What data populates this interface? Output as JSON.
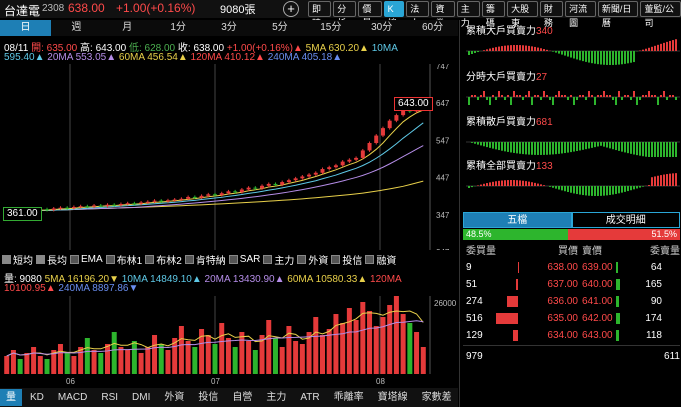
{
  "header": {
    "name": "台達電",
    "code": "2308",
    "price": "638.00",
    "change": "+1.00(+0.16%)",
    "volume": "9080張",
    "plus": "+"
  },
  "right_tabs": [
    "即時",
    "分析",
    "價量",
    "K線",
    "法人",
    "資券",
    "主力",
    "籌碼",
    "大股東",
    "財務",
    "河流圖",
    "新聞/日曆",
    "董監/公司"
  ],
  "active_right_tab": "K線",
  "period_tabs": [
    "日",
    "週",
    "月",
    "1分",
    "3分",
    "5分",
    "15分",
    "30分",
    "60分"
  ],
  "active_period": "日",
  "ohlc": {
    "date": "08/11",
    "open": "開: 635.00",
    "high": "高: 643.00",
    "low": "低: 628.00",
    "close": "收: 638.00",
    "chg": "+1.00(+0.16%)▲"
  },
  "ma": {
    "ma5": "5MA 630.20▲",
    "ma10": "10MA",
    "ma10v": "595.40▲",
    "ma20": "20MA 553.05▲",
    "ma60": "60MA 456.54▲",
    "ma120": "120MA 410.12▲",
    "ma240": "240MA 405.18▲"
  },
  "price_axis": [
    "747",
    "647",
    "547",
    "447",
    "347",
    "247"
  ],
  "high_tag": "643.00",
  "low_tag": "361.00",
  "indicators": [
    {
      "label": "短均",
      "on": true
    },
    {
      "label": "長均",
      "on": true
    },
    {
      "label": "EMA",
      "on": false
    },
    {
      "label": "布林1",
      "on": false
    },
    {
      "label": "布林2",
      "on": false
    },
    {
      "label": "肯特納",
      "on": false
    },
    {
      "label": "SAR",
      "on": false
    },
    {
      "label": "主力",
      "on": false
    },
    {
      "label": "外資",
      "on": false
    },
    {
      "label": "投信",
      "on": false
    },
    {
      "label": "融資",
      "on": false
    }
  ],
  "vol_line1": {
    "a": "量: 9080",
    "b": "5MA 16196.20▼",
    "c": "10MA 14849.10▲",
    "d": "20MA 13430.90▲",
    "e": "60MA 10580.33▲",
    "f": "120MA"
  },
  "vol_line2": {
    "a": "10100.95▲",
    "b": "240MA 8897.86▼"
  },
  "vol_axis": "26000",
  "months": [
    "06",
    "07",
    "08"
  ],
  "bottom_tabs": [
    "量",
    "KD",
    "MACD",
    "RSI",
    "DMI",
    "外資",
    "投信",
    "自營",
    "主力",
    "ATR",
    "乖離率",
    "寶塔線",
    "家數差"
  ],
  "active_bottom": "量",
  "side_panels": [
    {
      "label": "累積大戶買賣力",
      "value": "340"
    },
    {
      "label": "分時大戶買賣力",
      "value": "27"
    },
    {
      "label": "累積散戶買賣力",
      "value": "681"
    },
    {
      "label": "累積全部買賣力",
      "value": "133"
    }
  ],
  "order_tabs": [
    "五檔",
    "成交明細"
  ],
  "ratio": {
    "buy": "48.5%",
    "sell": "51.5%",
    "buy_frac": 0.485
  },
  "order_head": [
    "委買量",
    "買價",
    "賣價",
    "委賣量"
  ],
  "orders": [
    {
      "bq": "9",
      "bp": "638.00",
      "ap": "639.00",
      "aq": "64",
      "bw": 0.02,
      "aw": 0.35
    },
    {
      "bq": "51",
      "bp": "637.00",
      "ap": "640.00",
      "aq": "165",
      "bw": 0.1,
      "aw": 0.9
    },
    {
      "bq": "274",
      "bp": "636.00",
      "ap": "641.00",
      "aq": "90",
      "bw": 0.5,
      "aw": 0.5
    },
    {
      "bq": "516",
      "bp": "635.00",
      "ap": "642.00",
      "aq": "174",
      "bw": 1.0,
      "aw": 0.95
    },
    {
      "bq": "129",
      "bp": "634.00",
      "ap": "643.00",
      "aq": "118",
      "bw": 0.25,
      "aw": 0.65
    }
  ],
  "totals": {
    "buy": "979",
    "sell": "611"
  },
  "chart_data": {
    "type": "candlestick",
    "ylim": [
      247,
      747
    ],
    "close": [
      355,
      358,
      356,
      360,
      361,
      362,
      360,
      364,
      366,
      365,
      368,
      370,
      369,
      372,
      371,
      374,
      373,
      376,
      378,
      377,
      380,
      382,
      385,
      383,
      386,
      388,
      390,
      395,
      393,
      398,
      402,
      400,
      405,
      410,
      408,
      415,
      420,
      418,
      425,
      430,
      428,
      435,
      440,
      445,
      450,
      455,
      460,
      470,
      475,
      480,
      490,
      495,
      500,
      520,
      540,
      560,
      580,
      600,
      615,
      630,
      625,
      635,
      638
    ],
    "volume": [
      6,
      8,
      5,
      7,
      9,
      6,
      5,
      8,
      10,
      7,
      6,
      9,
      12,
      8,
      7,
      10,
      14,
      9,
      8,
      11,
      7,
      9,
      13,
      10,
      8,
      12,
      16,
      11,
      9,
      15,
      13,
      10,
      17,
      12,
      9,
      14,
      11,
      8,
      13,
      18,
      12,
      9,
      16,
      11,
      10,
      14,
      19,
      13,
      15,
      20,
      17,
      22,
      18,
      24,
      21,
      16,
      19,
      23,
      26,
      20,
      17,
      14,
      9
    ]
  }
}
